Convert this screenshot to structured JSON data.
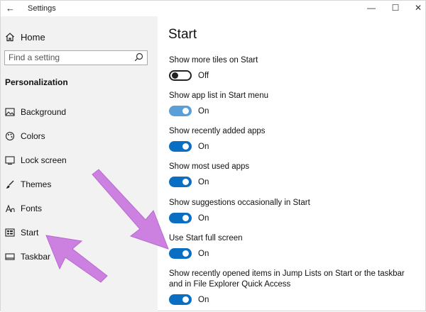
{
  "window": {
    "title": "Settings",
    "back_symbol": "←",
    "minimize_symbol": "—",
    "maximize_symbol": "☐",
    "close_symbol": "✕"
  },
  "sidebar": {
    "home": "Home",
    "search_placeholder": "Find a setting",
    "section": "Personalization",
    "items": [
      {
        "label": "Background",
        "icon": "image-icon"
      },
      {
        "label": "Colors",
        "icon": "palette-icon"
      },
      {
        "label": "Lock screen",
        "icon": "lock-screen-icon"
      },
      {
        "label": "Themes",
        "icon": "brush-icon"
      },
      {
        "label": "Fonts",
        "icon": "font-icon"
      },
      {
        "label": "Start",
        "icon": "start-icon"
      },
      {
        "label": "Taskbar",
        "icon": "taskbar-icon"
      }
    ]
  },
  "main": {
    "title": "Start",
    "settings": [
      {
        "label": "Show more tiles on Start",
        "state": "Off"
      },
      {
        "label": "Show app list in Start menu",
        "state": "On"
      },
      {
        "label": "Show recently added apps",
        "state": "On"
      },
      {
        "label": "Show most used apps",
        "state": "On"
      },
      {
        "label": "Show suggestions occasionally in Start",
        "state": "On"
      },
      {
        "label": "Use Start full screen",
        "state": "On"
      },
      {
        "label": "Show recently opened items in Jump Lists on Start or the taskbar and in File Explorer Quick Access",
        "state": "On"
      }
    ]
  },
  "colors": {
    "toggle_on": "#0a6fc2",
    "toggle_light": "#5a9fd8",
    "sidebar_bg": "#f2f2f2",
    "annotation_arrow": "#cc80e0"
  }
}
